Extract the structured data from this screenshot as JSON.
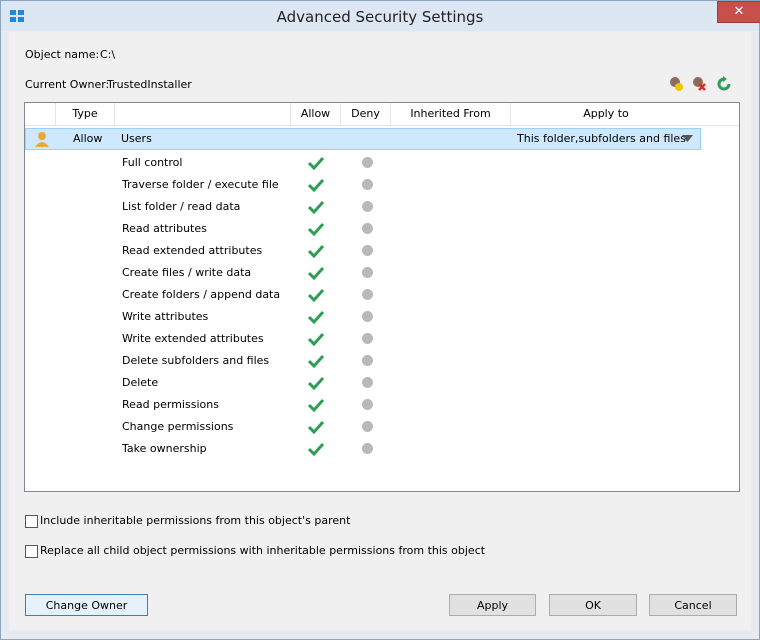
{
  "window": {
    "title": "Advanced Security Settings"
  },
  "object": {
    "label": "Object name:",
    "value": "C:\\"
  },
  "owner": {
    "label": "Current Owner:",
    "value": "TrustedInstaller"
  },
  "toolbar": {
    "icons": [
      "add-user-icon",
      "remove-user-icon",
      "refresh-icon"
    ]
  },
  "table": {
    "columns": [
      "Type",
      "Allow",
      "Deny",
      "Inherited From",
      "Apply to"
    ],
    "entry": {
      "type": "Allow",
      "principal": "Users",
      "inherited_from": "",
      "apply_to": "This folder,subfolders and files"
    },
    "permissions": [
      {
        "name": "Full control",
        "allow": true,
        "deny": false
      },
      {
        "name": "Traverse folder / execute file",
        "allow": true,
        "deny": false
      },
      {
        "name": "List folder / read data",
        "allow": true,
        "deny": false
      },
      {
        "name": "Read attributes",
        "allow": true,
        "deny": false
      },
      {
        "name": "Read extended attributes",
        "allow": true,
        "deny": false
      },
      {
        "name": "Create files / write data",
        "allow": true,
        "deny": false
      },
      {
        "name": "Create folders / append data",
        "allow": true,
        "deny": false
      },
      {
        "name": "Write attributes",
        "allow": true,
        "deny": false
      },
      {
        "name": "Write extended attributes",
        "allow": true,
        "deny": false
      },
      {
        "name": "Delete subfolders and files",
        "allow": true,
        "deny": false
      },
      {
        "name": "Delete",
        "allow": true,
        "deny": false
      },
      {
        "name": "Read permissions",
        "allow": true,
        "deny": false
      },
      {
        "name": "Change permissions",
        "allow": true,
        "deny": false
      },
      {
        "name": "Take ownership",
        "allow": true,
        "deny": false
      }
    ]
  },
  "options": {
    "include_inheritable": {
      "label": "Include inheritable permissions from this object's parent",
      "checked": false
    },
    "replace_child": {
      "label": "Replace all child object permissions with inheritable permissions from this object",
      "checked": false
    }
  },
  "buttons": {
    "change_owner": "Change Owner",
    "apply": "Apply",
    "ok": "OK",
    "cancel": "Cancel"
  },
  "colors": {
    "check": "#2e9e57",
    "selection": "#cde8ff"
  }
}
